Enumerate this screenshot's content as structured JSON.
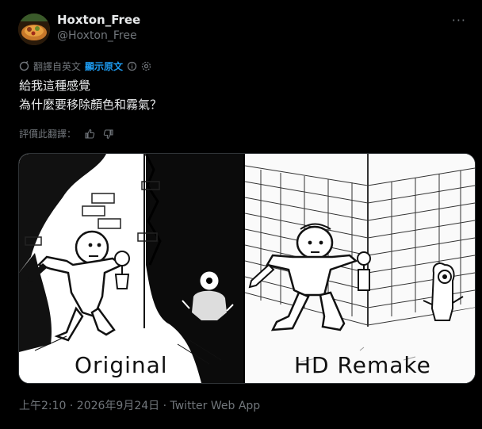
{
  "author": {
    "display_name": "Hoxton_Free",
    "handle": "@Hoxton_Free"
  },
  "menu": {
    "more_label": "···"
  },
  "translation": {
    "source_label": "翻譯自英文",
    "show_original_label": "顯示原文"
  },
  "tweet": {
    "line1": "給我這種感覺",
    "line2": "為什麼要移除顏色和霧氣？"
  },
  "rating": {
    "label": "評價此翻譯："
  },
  "media": {
    "left_label": "Original",
    "right_label": "HD Remake"
  },
  "meta": {
    "timestamp": "上午2:10 · 2026年9月24日 · Twitter Web App"
  },
  "colors": {
    "background": "#000000",
    "text": "#e7e9ea",
    "muted": "#71767b",
    "link": "#1d9bf0"
  }
}
